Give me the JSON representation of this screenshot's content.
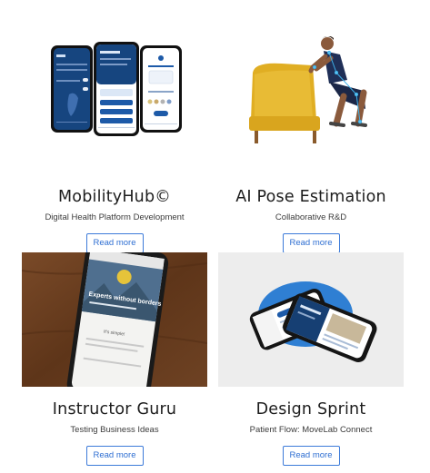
{
  "cards": [
    {
      "title": "MobilityHub©",
      "subtitle": "Digital Health Platform Development",
      "button": "Read more",
      "image": "three-phone-app-screens"
    },
    {
      "title": "AI Pose Estimation",
      "subtitle": "Collaborative R&D",
      "button": "Read more",
      "image": "man-squatting-to-yellow-bench"
    },
    {
      "title": "Instructor Guru",
      "subtitle": "Testing Business Ideas",
      "button": "Read more",
      "image": "phone-on-wooden-table",
      "screen_text": {
        "headline": "Experts without borders",
        "section": "It's simple!"
      }
    },
    {
      "title": "Design Sprint",
      "subtitle": "Patient Flow: MoveLab Connect",
      "button": "Read more",
      "image": "two-phones-on-blue-circle"
    }
  ],
  "colors": {
    "button_border": "#3d7bd9",
    "button_text": "#2f6fd2",
    "app_navy": "#0f3d78",
    "bench_yellow": "#e4b52a",
    "wood": "#6b3f22"
  }
}
